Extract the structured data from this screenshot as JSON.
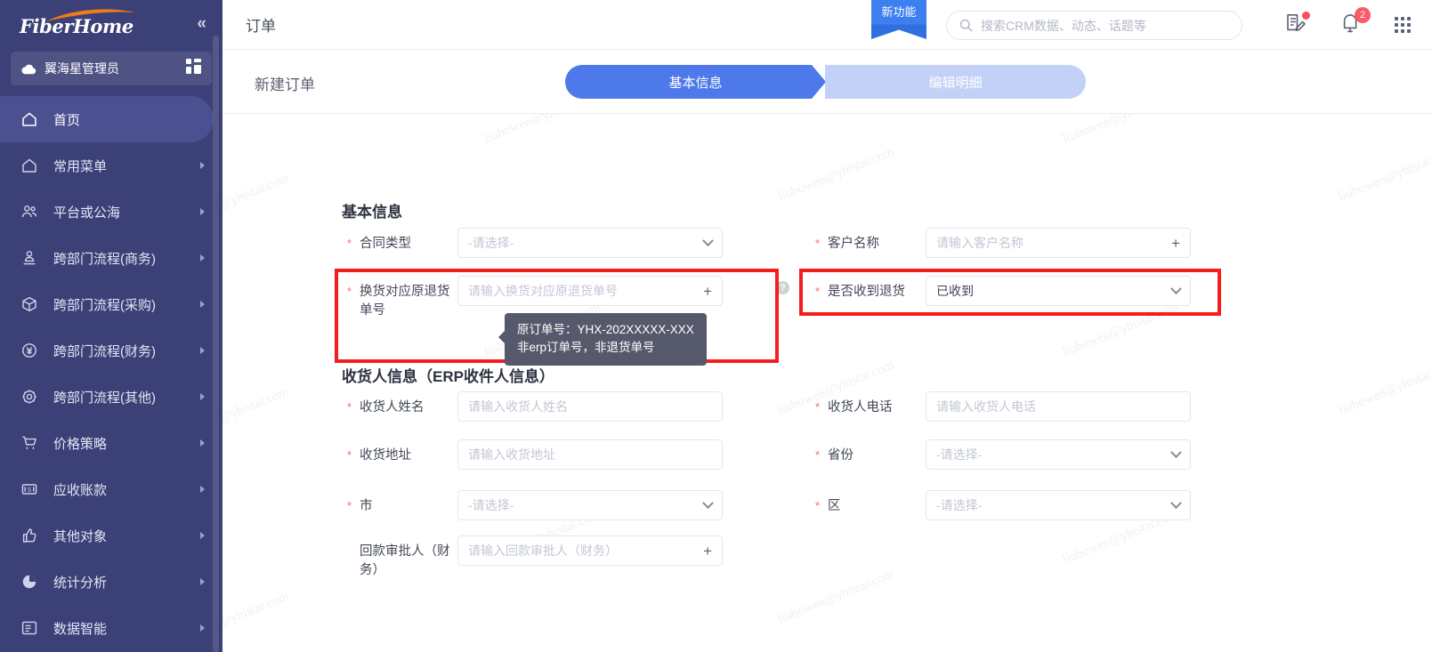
{
  "brand": {
    "name": "FiberHome",
    "accent": "#f07a1e",
    "sidebar_bg": "#3b4077"
  },
  "sidebar": {
    "collapse_icon": "«",
    "user": {
      "label": "翼海星管理员",
      "icon": "cloud-icon",
      "grid_icon": "grid-icon"
    },
    "items": [
      {
        "label": "首页",
        "icon": "home-icon",
        "active": true,
        "arrow": false
      },
      {
        "label": "常用菜单",
        "icon": "home2-icon",
        "active": false,
        "arrow": true
      },
      {
        "label": "平台或公海",
        "icon": "users-icon",
        "active": false,
        "arrow": true
      },
      {
        "label": "跨部门流程(商务)",
        "icon": "person-icon",
        "active": false,
        "arrow": true
      },
      {
        "label": "跨部门流程(采购)",
        "icon": "box-icon",
        "active": false,
        "arrow": true
      },
      {
        "label": "跨部门流程(财务)",
        "icon": "yen-icon",
        "active": false,
        "arrow": true
      },
      {
        "label": "跨部门流程(其他)",
        "icon": "gear-icon",
        "active": false,
        "arrow": true
      },
      {
        "label": "价格策略",
        "icon": "cart-icon",
        "active": false,
        "arrow": true
      },
      {
        "label": "应收账款",
        "icon": "receipt-icon",
        "active": false,
        "arrow": true
      },
      {
        "label": "其他对象",
        "icon": "thumb-icon",
        "active": false,
        "arrow": true
      },
      {
        "label": "统计分析",
        "icon": "pie-icon",
        "active": false,
        "arrow": true
      },
      {
        "label": "数据智能",
        "icon": "data-icon",
        "active": false,
        "arrow": true
      }
    ]
  },
  "topbar": {
    "page_title": "订单",
    "ribbon_label": "新功能",
    "search": {
      "placeholder": "搜索CRM数据、动态、话题等",
      "value": "",
      "icon": "search-icon"
    },
    "icons": [
      {
        "name": "note-edit-icon",
        "badge_dot": true
      },
      {
        "name": "bell-icon",
        "badge_count": "2"
      },
      {
        "name": "apps-grid-icon"
      }
    ]
  },
  "stepbar": {
    "sub_title": "新建订单",
    "steps": [
      {
        "label": "基本信息",
        "active": true
      },
      {
        "label": "编辑明细",
        "active": false
      }
    ]
  },
  "form": {
    "section1_title": "基本信息",
    "section2_title": "收货人信息（ERP收件人信息）",
    "fields": {
      "contract_type": {
        "label": "合同类型",
        "placeholder": "-请选择-",
        "value": "",
        "type": "select",
        "required": true
      },
      "customer_name": {
        "label": "客户名称",
        "placeholder": "请输入客户名称",
        "value": "",
        "type": "addinput",
        "required": true
      },
      "exchange_order": {
        "label": "换货对应原退货单号",
        "placeholder": "请输入换货对应原退货单号",
        "value": "",
        "type": "addinput",
        "required": true
      },
      "received_return": {
        "label": "是否收到退货",
        "placeholder": "",
        "value": "已收到",
        "type": "select",
        "required": true
      },
      "receiver_name": {
        "label": "收货人姓名",
        "placeholder": "请输入收货人姓名",
        "value": "",
        "type": "input",
        "required": true
      },
      "receiver_phone": {
        "label": "收货人电话",
        "placeholder": "请输入收货人电话",
        "value": "",
        "type": "input",
        "required": true
      },
      "receiver_addr": {
        "label": "收货地址",
        "placeholder": "请输入收货地址",
        "value": "",
        "type": "input",
        "required": true
      },
      "province": {
        "label": "省份",
        "placeholder": "-请选择-",
        "value": "",
        "type": "select",
        "required": true
      },
      "city": {
        "label": "市",
        "placeholder": "-请选择-",
        "value": "",
        "type": "select",
        "required": true
      },
      "district": {
        "label": "区",
        "placeholder": "-请选择-",
        "value": "",
        "type": "select",
        "required": true
      },
      "approver": {
        "label": "回款审批人（财务）",
        "placeholder": "请输入回款审批人（财务）",
        "value": "",
        "type": "addinput",
        "required": false
      }
    },
    "tooltip": {
      "line1": "原订单号：YHX-202XXXXX-XXX",
      "line2": "非erp订单号，非退货单号"
    },
    "help_icon": "?",
    "highlight_color": "#f51d1d"
  },
  "watermark": {
    "text": "liubowen@yhistar.com"
  }
}
